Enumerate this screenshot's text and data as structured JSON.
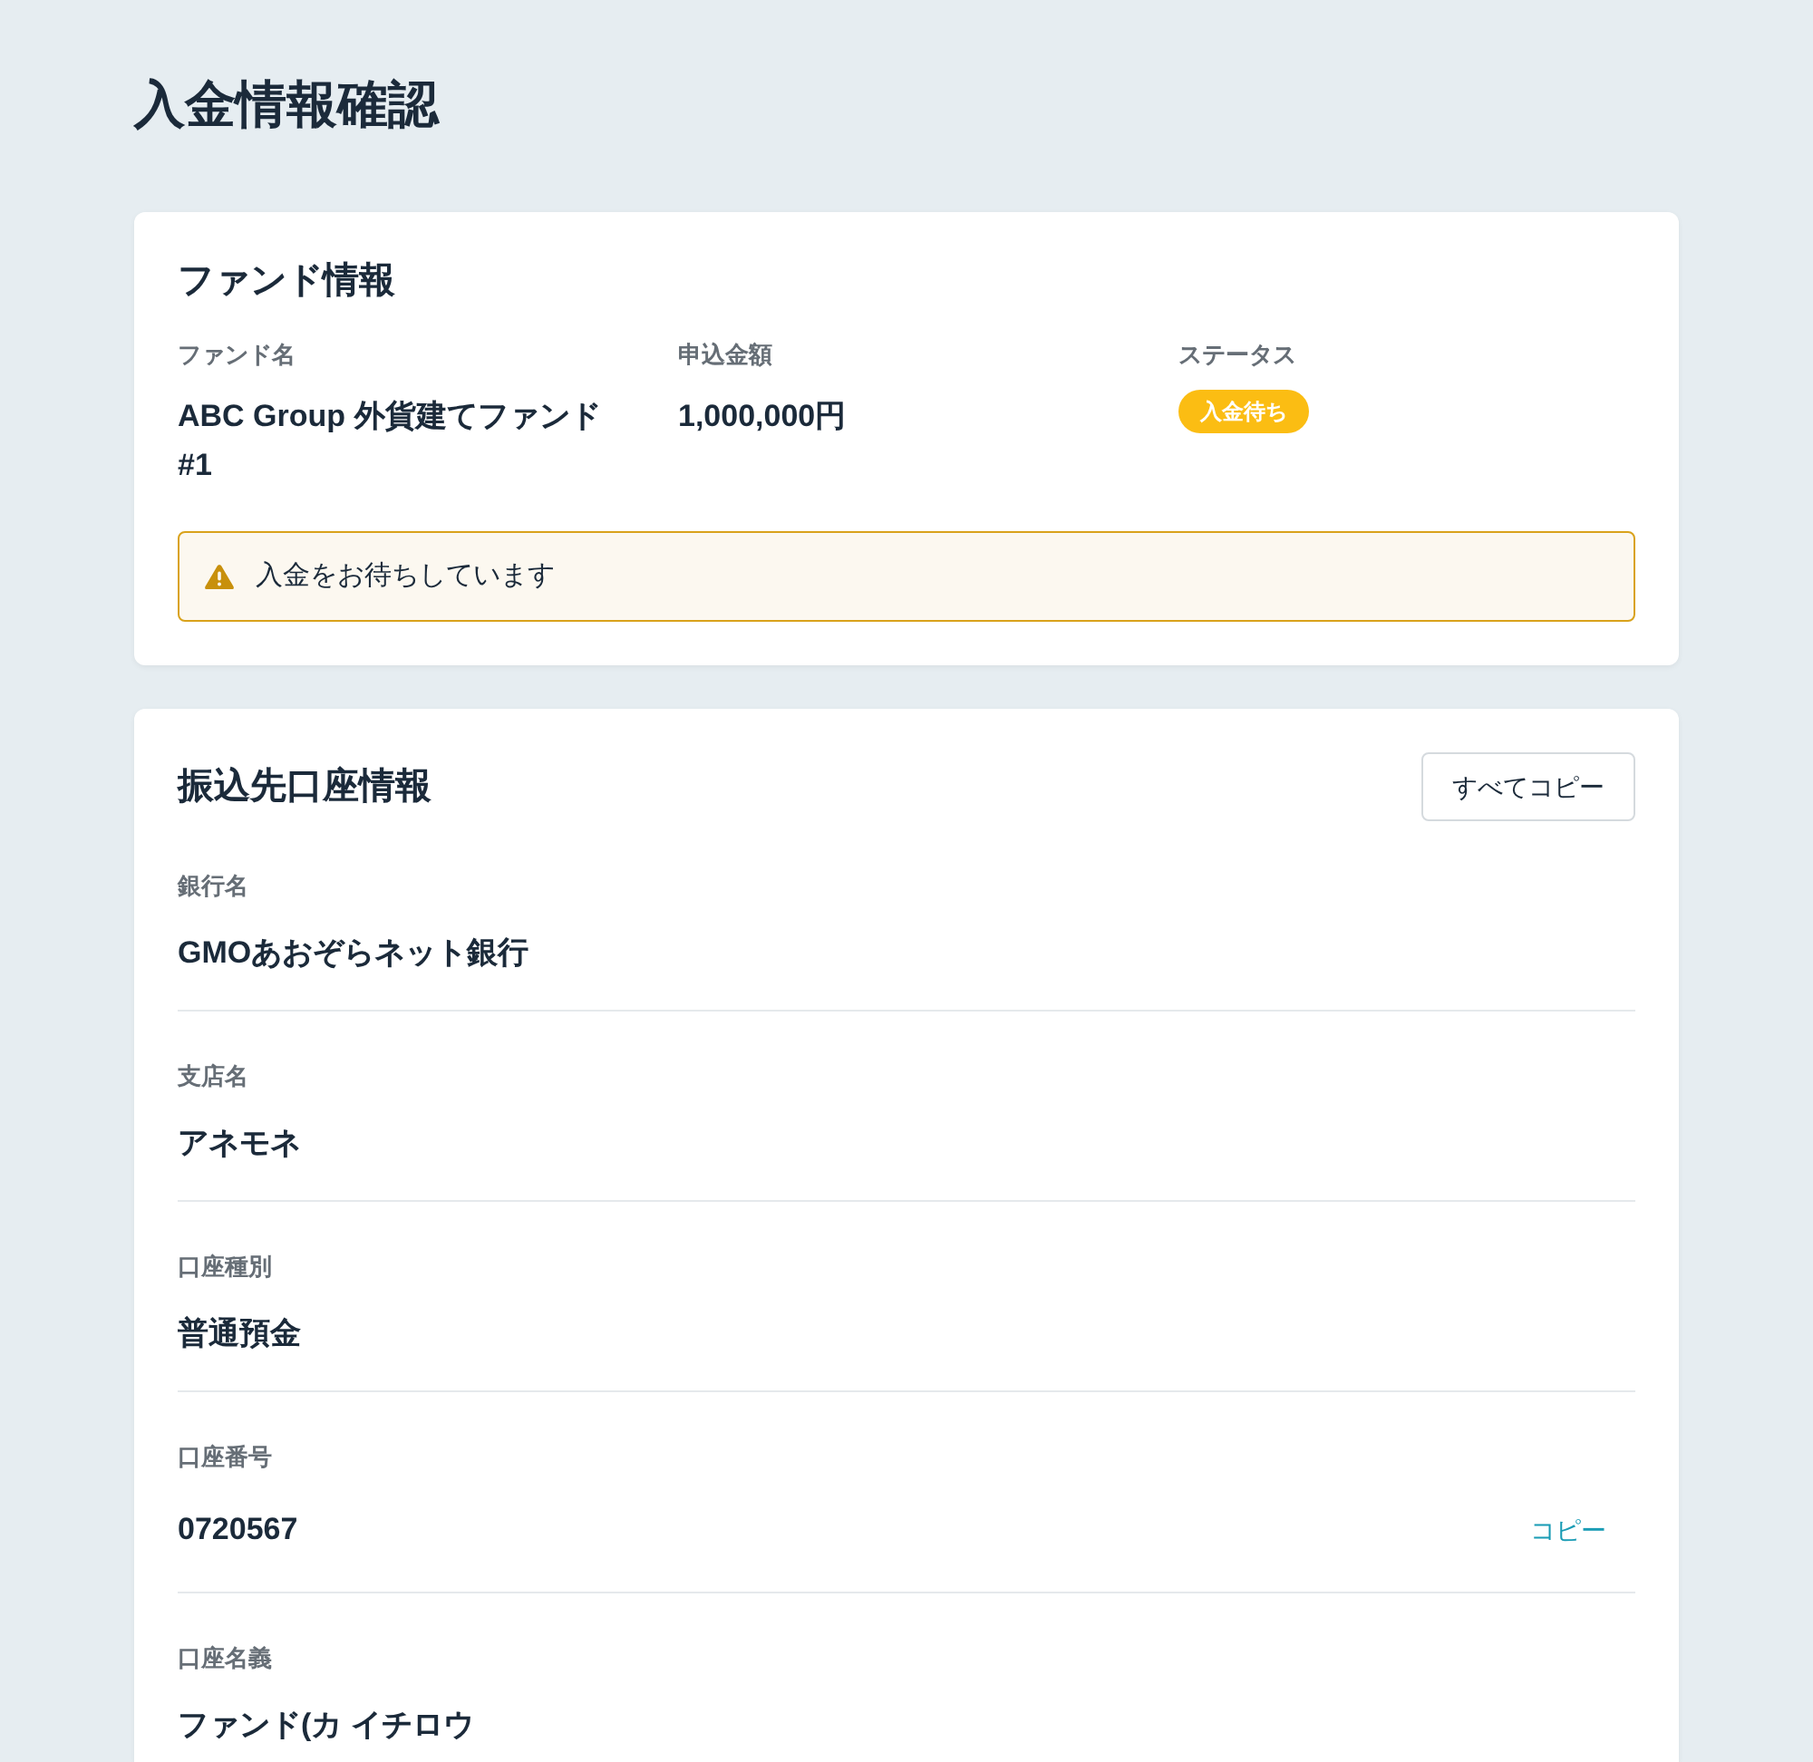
{
  "page": {
    "title": "入金情報確認"
  },
  "fund_info": {
    "heading": "ファンド情報",
    "fields": [
      {
        "kind": "text",
        "label": "ファンド名",
        "value": "ABC Group 外貨建てファンド #1"
      },
      {
        "kind": "text",
        "label": "申込金額",
        "value": "1,000,000円"
      },
      {
        "kind": "badge",
        "label": "ステータス",
        "value": "入金待ち"
      }
    ],
    "alert": {
      "kind": "warning",
      "message": "入金をお待ちしています"
    }
  },
  "account_info": {
    "heading": "振込先口座情報",
    "copy_all_button": "すべてコピー",
    "rows": [
      {
        "label": "銀行名",
        "value": "GMOあおぞらネット銀行"
      },
      {
        "label": "支店名",
        "value": "アネモネ"
      },
      {
        "label": "口座種別",
        "value": "普通預金"
      },
      {
        "label": "口座番号",
        "value": "0720567",
        "copy_button": "コピー"
      },
      {
        "label": "口座名義",
        "value": "ファンド(カ イチロウ"
      }
    ]
  }
}
